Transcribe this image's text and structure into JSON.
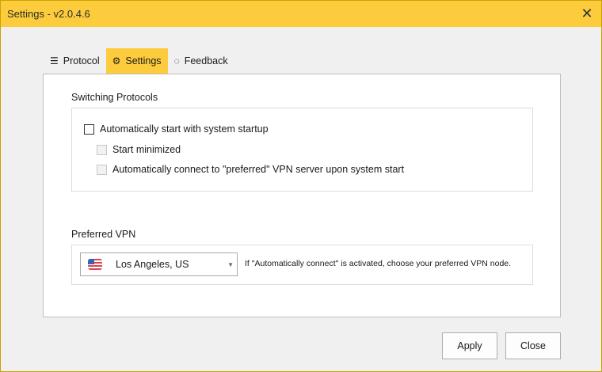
{
  "window": {
    "title": "Settings - v2.0.4.6",
    "close_glyph": "✕"
  },
  "tabs": [
    {
      "label": "Protocol",
      "icon": "sliders-icon",
      "glyph": "☰",
      "active": false
    },
    {
      "label": "Settings",
      "icon": "gear-icon",
      "glyph": "⚙",
      "active": true
    },
    {
      "label": "Feedback",
      "icon": "speech-bubble-icon",
      "glyph": "◌",
      "active": false
    }
  ],
  "switching": {
    "heading": "Switching Protocols",
    "auto_start": {
      "label": "Automatically start with system startup",
      "checked": false
    },
    "start_minimized": {
      "label": "Start minimized",
      "checked": false,
      "enabled": false
    },
    "auto_connect": {
      "label": "Automatically connect to \"preferred\" VPN server upon system start",
      "checked": false,
      "enabled": false
    }
  },
  "preferred_vpn": {
    "heading": "Preferred VPN",
    "selected": "Los Angeles, US",
    "hint": "If \"Automatically connect\" is activated, choose your preferred VPN node."
  },
  "footer": {
    "apply_label": "Apply",
    "close_label": "Close"
  },
  "colors": {
    "accent": "#fccc3c"
  }
}
